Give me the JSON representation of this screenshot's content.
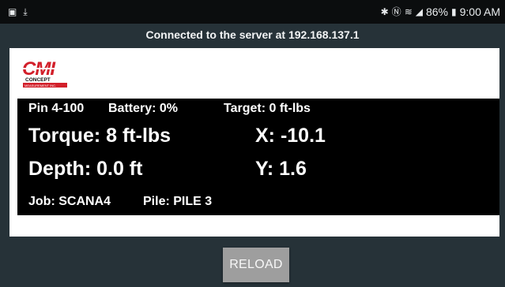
{
  "status_bar": {
    "left_icons": [
      "gallery-icon",
      "download-icon"
    ],
    "right_icons": [
      "bluetooth-icon",
      "nfc-icon",
      "wifi-icon",
      "signal-icon"
    ],
    "battery": "86%",
    "time": "9:00 AM"
  },
  "connection": {
    "message": "Connected to the server at 192.168.137.1"
  },
  "logo": {
    "text": "CMI",
    "sub1": "CONCEPT",
    "sub2": "MEASUREMENT INC."
  },
  "device": {
    "pin": "Pin 4-100",
    "battery": "Battery: 0%",
    "target": "Target: 0 ft-lbs",
    "torque": "Torque: 8 ft-lbs",
    "x": "X: -10.1",
    "depth": "Depth: 0.0 ft",
    "y": "Y: 1.6",
    "job": "Job: SCANA4",
    "pile": "Pile: PILE 3"
  },
  "actions": {
    "reload": "RELOAD"
  },
  "colors": {
    "background": "#263238",
    "status_bar": "#0b0d0e",
    "logo_red": "#d21f2a",
    "button": "#9e9e9e"
  }
}
